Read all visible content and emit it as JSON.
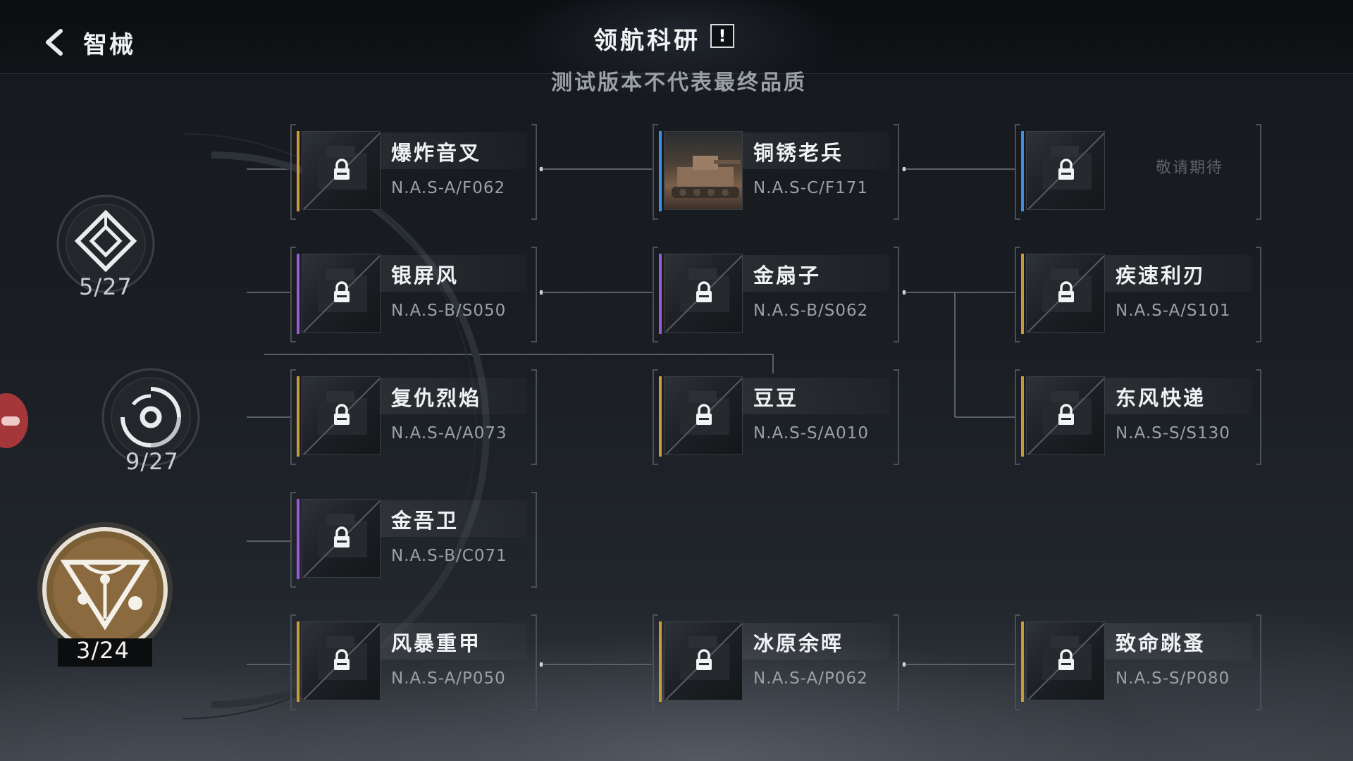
{
  "header": {
    "back_label": "智械",
    "title": "领航科研",
    "alert_label": "!",
    "subtitle": "测试版本不代表最终品质"
  },
  "categories": [
    {
      "id": "cat1",
      "count": "5/27",
      "icon": "diamond-emblem-icon",
      "active": false
    },
    {
      "id": "cat2",
      "count": "9/27",
      "icon": "swirl-emblem-icon",
      "active": false
    },
    {
      "id": "cat3",
      "count": "3/24",
      "icon": "triangle-emblem-icon",
      "active": true
    }
  ],
  "colors": {
    "rarity_gold": "#c89a3a",
    "rarity_purple": "#9a5ad8",
    "rarity_blue": "#3f8fe0",
    "active_emblem": "#8a6a3a",
    "side_tab": "#a5373b"
  },
  "cards": [
    {
      "id": "c1",
      "name": "爆炸音叉",
      "code": "N.A.S-A/F062",
      "rarity": "gold",
      "locked": true
    },
    {
      "id": "c2",
      "name": "铜锈老兵",
      "code": "N.A.S-C/F171",
      "rarity": "blue",
      "locked": false
    },
    {
      "id": "c3",
      "name": "",
      "code": "",
      "rarity": "blue",
      "locked": true,
      "placeholder": "敬请期待"
    },
    {
      "id": "c4",
      "name": "银屏风",
      "code": "N.A.S-B/S050",
      "rarity": "purple",
      "locked": true
    },
    {
      "id": "c5",
      "name": "金扇子",
      "code": "N.A.S-B/S062",
      "rarity": "purple",
      "locked": true
    },
    {
      "id": "c6",
      "name": "疾速利刃",
      "code": "N.A.S-A/S101",
      "rarity": "gold",
      "locked": true
    },
    {
      "id": "c7",
      "name": "复仇烈焰",
      "code": "N.A.S-A/A073",
      "rarity": "gold",
      "locked": true
    },
    {
      "id": "c8",
      "name": "豆豆",
      "code": "N.A.S-S/A010",
      "rarity": "gold",
      "locked": true
    },
    {
      "id": "c9",
      "name": "东风快递",
      "code": "N.A.S-S/S130",
      "rarity": "gold",
      "locked": true
    },
    {
      "id": "c10",
      "name": "金吾卫",
      "code": "N.A.S-B/C071",
      "rarity": "purple",
      "locked": true
    },
    {
      "id": "c11",
      "name": "风暴重甲",
      "code": "N.A.S-A/P050",
      "rarity": "gold",
      "locked": true
    },
    {
      "id": "c12",
      "name": "冰原余晖",
      "code": "N.A.S-A/P062",
      "rarity": "gold",
      "locked": true
    },
    {
      "id": "c13",
      "name": "致命跳蚤",
      "code": "N.A.S-S/P080",
      "rarity": "gold",
      "locked": true
    }
  ]
}
